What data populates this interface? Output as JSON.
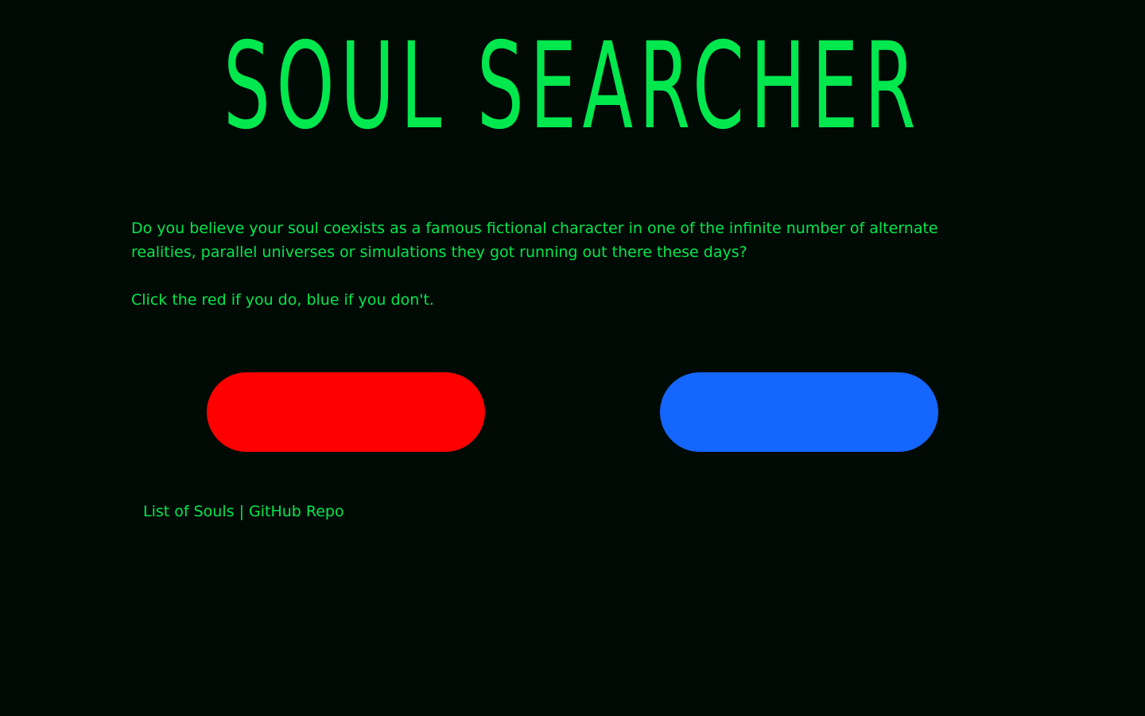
{
  "header": {
    "title": "SOUL SEARCHER"
  },
  "intro": {
    "question": "Do you believe your soul coexists as a famous fictional character in one of the infinite number of alternate realities, parallel universes or simulations they got running out there these days?",
    "instruction": "Click the red if you do, blue if you don't."
  },
  "pills": {
    "red": {
      "color": "#ff0000",
      "icon": "red-pill"
    },
    "blue": {
      "color": "#1565ff",
      "icon": "blue-pill"
    }
  },
  "footer": {
    "list_link": "List of Souls",
    "separator": "|",
    "repo_link": "GitHub Repo"
  },
  "colors": {
    "background": "#000a05",
    "text": "#00e84d"
  }
}
